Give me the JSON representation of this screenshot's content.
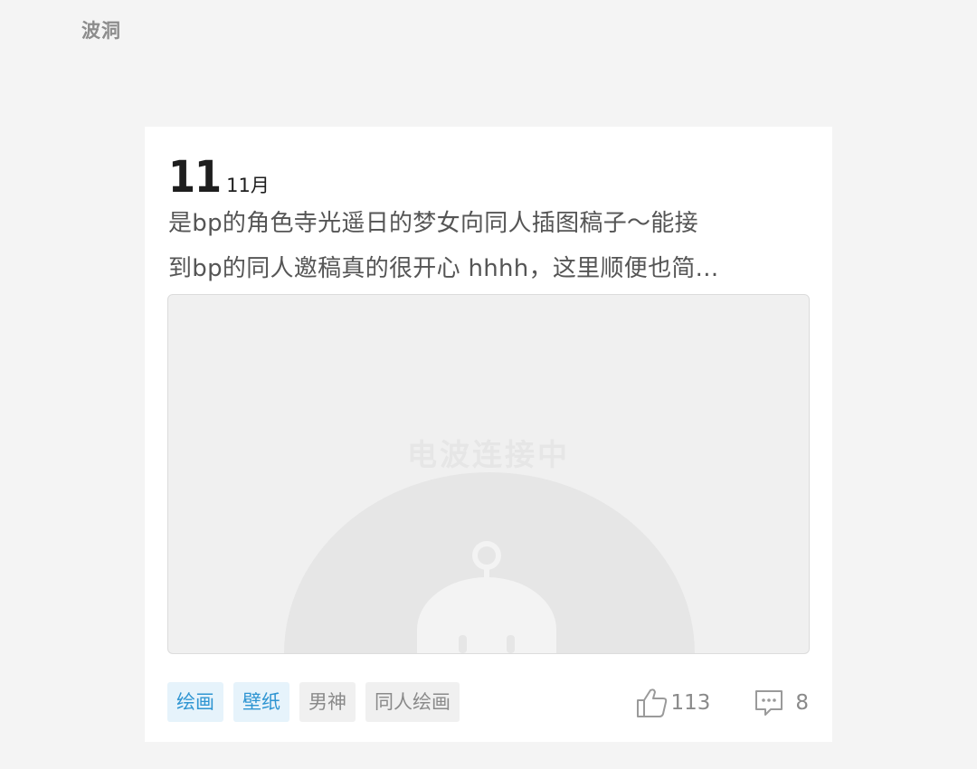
{
  "section": {
    "title": "波洞"
  },
  "post": {
    "date": {
      "day": "11",
      "month": "11月"
    },
    "description_lines": [
      "是bp的角色寺光遥日的梦女向同人插图稿子～能接",
      "到bp的同人邀稿真的很开心 hhhh，这里顺便也简..."
    ],
    "image": {
      "loading_text": "电波连接中"
    },
    "tags": [
      {
        "label": "绘画",
        "kind": "topic"
      },
      {
        "label": "壁纸",
        "kind": "topic"
      },
      {
        "label": "男神",
        "kind": "plain"
      },
      {
        "label": "同人绘画",
        "kind": "plain"
      }
    ],
    "likes": "113",
    "comments": "8"
  },
  "colors": {
    "background": "#f4f4f4",
    "card": "#ffffff",
    "topic_tag_text": "#2f95d2",
    "topic_tag_bg": "#e6f3fb",
    "plain_tag_text": "#8a8a8a",
    "plain_tag_bg": "#f0f0f0"
  }
}
